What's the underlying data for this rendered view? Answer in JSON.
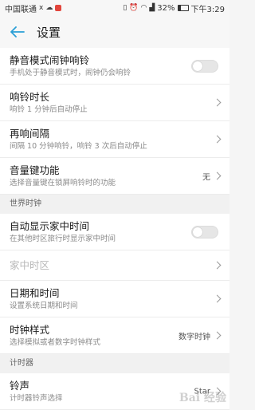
{
  "status_bar": {
    "carrier": "中国联通",
    "carrier_icons": [
      "signal-icon",
      "wechat-icon",
      "app-icon"
    ],
    "right_icons": [
      "vibrate-icon",
      "alarm-icon",
      "wifi-icon",
      "signal-icon"
    ],
    "battery": "32%",
    "time": "下午3:29"
  },
  "header": {
    "title": "设置"
  },
  "items": [
    {
      "title": "静音模式闹钟响铃",
      "subtitle": "手机处于静音模式时，闹钟仍会响铃",
      "control": "toggle",
      "toggle_on": false
    },
    {
      "title": "响铃时长",
      "subtitle": "响铃 1 分钟后自动停止",
      "control": "chevron"
    },
    {
      "title": "再响间隔",
      "subtitle": "间隔 10 分钟响铃，响铃 3 次后自动停止",
      "control": "chevron"
    },
    {
      "title": "音量键功能",
      "subtitle": "选择音量键在锁屏响铃时的功能",
      "value": "无",
      "control": "chevron"
    }
  ],
  "section_world": {
    "label": "世界时钟"
  },
  "world_items": [
    {
      "title": "自动显示家中时间",
      "subtitle": "在其他时区旅行时显示家中时间",
      "control": "toggle",
      "toggle_on": false
    },
    {
      "title": "家中时区",
      "control": "chevron",
      "disabled": true
    },
    {
      "title": "日期和时间",
      "subtitle": "设置系统日期和时间",
      "control": "chevron"
    },
    {
      "title": "时钟样式",
      "subtitle": "选择模拟或者数字时钟样式",
      "value": "数字时钟",
      "control": "chevron"
    }
  ],
  "section_timer": {
    "label": "计时器"
  },
  "timer_items": [
    {
      "title": "铃声",
      "subtitle": "计时器铃声选择",
      "value": "Star",
      "control": "chevron"
    }
  ],
  "watermark": "Bai 经验"
}
